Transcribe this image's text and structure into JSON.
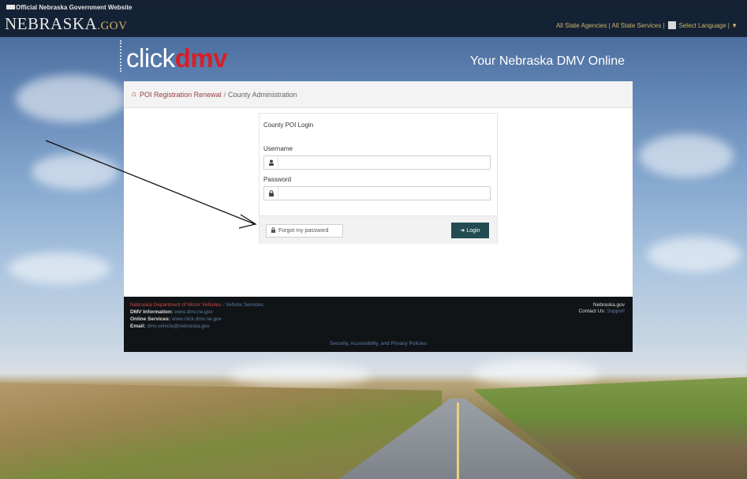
{
  "gov_bar": {
    "official_label": "Official Nebraska Government Website",
    "logo_main": "NEBRASKA",
    "logo_suffix": ".GOV",
    "links": "All State Agencies | All State Services |",
    "language_label": "Select Language | ▼"
  },
  "header": {
    "brand_click": "click",
    "brand_dmv": "dmv",
    "tagline": "Your Nebraska DMV Online"
  },
  "breadcrumb": {
    "home_icon": "home-icon",
    "item1": "POI Registration Renewal",
    "separator": "/",
    "current": "County Administration"
  },
  "login": {
    "title": "County POI Login",
    "username_label": "Username",
    "username_value": "",
    "username_icon": "user-icon",
    "password_label": "Password",
    "password_value": "",
    "password_icon": "lock-icon",
    "forgot_label": "Forgot my password",
    "login_label": "Login"
  },
  "footer": {
    "dept": "Nebraska Department of Motor Vehicles",
    "dept_sub": "- Vehicle Services",
    "dmv_info_key": "DMV Information:",
    "dmv_info_val": "www.dmv.ne.gov",
    "online_key": "Online Services:",
    "online_val": "www.click.dmv.ne.gov",
    "email_key": "Email:",
    "email_val": "dmv.vehicle@nebraska.gov",
    "right1": "Nebraska.gov",
    "right2_key": "Contact Us:",
    "right2_val": "Support",
    "policies": "Security, Accessibility, and Privacy Policies"
  },
  "colors": {
    "accent_red": "#d61f26",
    "login_button": "#234c52",
    "footer_bg": "#111417"
  }
}
